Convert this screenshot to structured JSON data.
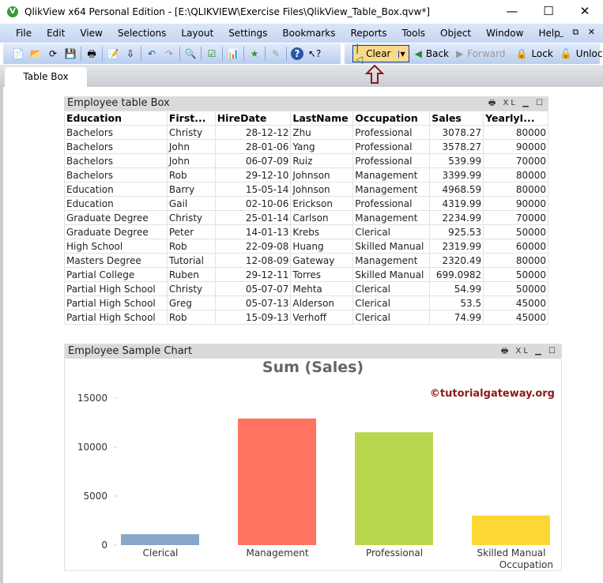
{
  "window": {
    "title": "QlikView x64 Personal Edition - [E:\\QLIKVIEW\\Exercise Files\\QlikView_Table_Box.qvw*]",
    "app_icon": "V",
    "minimize": "—",
    "maximize": "☐",
    "close": "✕"
  },
  "menu": [
    "File",
    "Edit",
    "View",
    "Selections",
    "Layout",
    "Settings",
    "Bookmarks",
    "Reports",
    "Tools",
    "Object",
    "Window",
    "Help"
  ],
  "toolbar": {
    "clear": "Clear",
    "back": "Back",
    "forward": "Forward",
    "lock": "Lock",
    "unlock": "Unlock"
  },
  "tabs": [
    {
      "label": "Table Box",
      "active": true
    }
  ],
  "table_box": {
    "title": "Employee table Box",
    "columns": [
      "Education",
      "First...",
      "HireDate",
      "LastName",
      "Occupation",
      "Sales",
      "YearlyI..."
    ],
    "rows": [
      [
        "Bachelors",
        "Christy",
        "28-12-12",
        "Zhu",
        "Professional",
        "3078.27",
        "80000"
      ],
      [
        "Bachelors",
        "John",
        "28-01-06",
        "Yang",
        "Professional",
        "3578.27",
        "90000"
      ],
      [
        "Bachelors",
        "John",
        "06-07-09",
        "Ruiz",
        "Professional",
        "539.99",
        "70000"
      ],
      [
        "Bachelors",
        "Rob",
        "29-12-10",
        "Johnson",
        "Management",
        "3399.99",
        "80000"
      ],
      [
        "Education",
        "Barry",
        "15-05-14",
        "Johnson",
        "Management",
        "4968.59",
        "80000"
      ],
      [
        "Education",
        "Gail",
        "02-10-06",
        "Erickson",
        "Professional",
        "4319.99",
        "90000"
      ],
      [
        "Graduate Degree",
        "Christy",
        "25-01-14",
        "Carlson",
        "Management",
        "2234.99",
        "70000"
      ],
      [
        "Graduate Degree",
        "Peter",
        "14-01-13",
        "Krebs",
        "Clerical",
        "925.53",
        "50000"
      ],
      [
        "High School",
        "Rob",
        "22-09-08",
        "Huang",
        "Skilled Manual",
        "2319.99",
        "60000"
      ],
      [
        "Masters Degree",
        "Tutorial",
        "12-08-09",
        "Gateway",
        "Management",
        "2320.49",
        "80000"
      ],
      [
        "Partial College",
        "Ruben",
        "29-12-11",
        "Torres",
        "Skilled Manual",
        "699.0982",
        "50000"
      ],
      [
        "Partial High School",
        "Christy",
        "05-07-07",
        "Mehta",
        "Clerical",
        "54.99",
        "50000"
      ],
      [
        "Partial High School",
        "Greg",
        "05-07-13",
        "Alderson",
        "Clerical",
        "53.5",
        "45000"
      ],
      [
        "Partial High School",
        "Rob",
        "15-09-13",
        "Verhoff",
        "Clerical",
        "74.99",
        "45000"
      ]
    ]
  },
  "chart_box": {
    "caption": "Employee Sample Chart",
    "watermark": "©tutorialgateway.org"
  },
  "chart_data": {
    "type": "bar",
    "title": "Sum (Sales)",
    "xlabel": "Occupation",
    "ylabel": "",
    "categories": [
      "Clerical",
      "Management",
      "Professional",
      "Skilled Manual"
    ],
    "values": [
      1109.01,
      12924.06,
      11516.52,
      3019.09
    ],
    "colors": [
      "#87a7c8",
      "#ff7360",
      "#b9d74e",
      "#fdd835"
    ],
    "yticks": [
      0,
      5000,
      10000,
      15000
    ],
    "ylim": [
      0,
      15000
    ]
  }
}
